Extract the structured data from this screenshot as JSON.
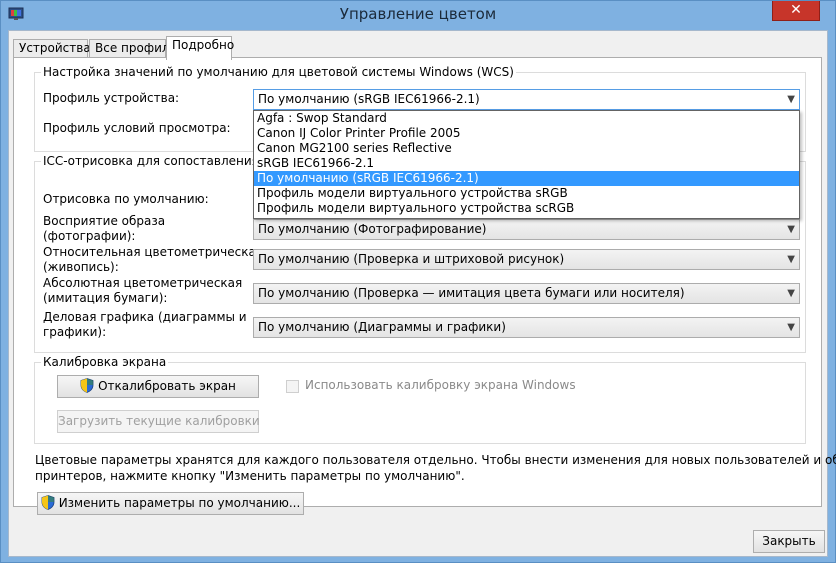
{
  "window": {
    "title": "Управление цветом",
    "close_glyph": "✕"
  },
  "tabs": [
    "Устройства",
    "Все профили",
    "Подробно"
  ],
  "wcs_group": {
    "title": "Настройка значений по умолчанию для цветовой системы Windows (WCS)",
    "device_profile_label": "Профиль устройства:",
    "device_profile_value": "По умолчанию (sRGB IEC61966-2.1)",
    "viewing_label": "Профиль условий просмотра:",
    "dropdown_options": [
      "Agfa : Swop Standard",
      "Canon IJ Color Printer Profile 2005",
      "Canon MG2100 series Reflective",
      "sRGB IEC61966-2.1",
      "По умолчанию (sRGB IEC61966-2.1)",
      "Профиль модели виртуального устройства sRGB",
      "Профиль модели виртуального устройства scRGB"
    ],
    "selected_option_index": 4
  },
  "icc_group": {
    "title": "ICC-отрисовка для сопоставления цве",
    "default_rendering_label": "Отрисовка по умолчанию:",
    "rows": [
      {
        "label1": "Восприятие образа",
        "label2": "(фотографии):",
        "value": "По умолчанию (Фотографирование)"
      },
      {
        "label1": "Относительная цветометрическая",
        "label2": "(живопись):",
        "value": "По умолчанию (Проверка и штриховой рисунок)"
      },
      {
        "label1": "Абсолютная цветометрическая",
        "label2": "(имитация бумаги):",
        "value": "По умолчанию (Проверка — имитация цвета бумаги или носителя)"
      },
      {
        "label1": "Деловая графика (диаграммы и",
        "label2": "графики):",
        "value": "По умолчанию (Диаграммы и графики)"
      }
    ]
  },
  "calibration_group": {
    "title": "Калибровка экрана",
    "calibrate_button": "Откалибровать экран",
    "use_windows_calibration": "Использовать калибровку экрана Windows",
    "load_calibrations_button": "Загрузить текущие калибровки"
  },
  "info_text": {
    "line1": "Цветовые параметры хранятся для каждого пользователя отдельно. Чтобы внести изменения для новых пользователей и общих",
    "line2": "принтеров, нажмите кнопку \"Изменить параметры по умолчанию\"."
  },
  "change_defaults_button": "Изменить параметры по умолчанию...",
  "close_button": "Закрыть",
  "icons": {
    "shield": "uac-shield-icon",
    "arrow": "chevron-down-icon"
  }
}
